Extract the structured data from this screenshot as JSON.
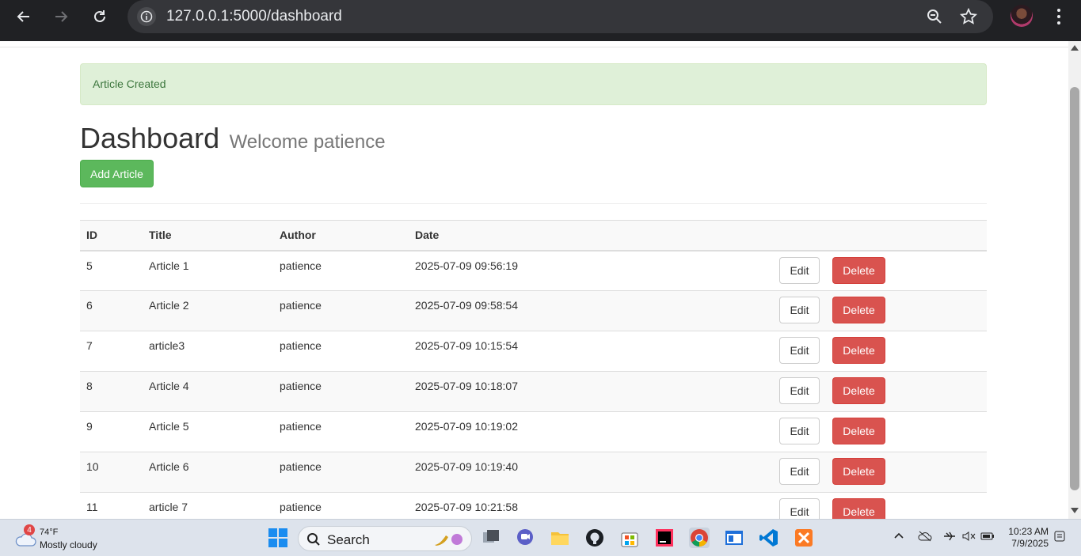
{
  "browser": {
    "url": "127.0.0.1:5000/dashboard"
  },
  "alert": {
    "message": "Article Created"
  },
  "header": {
    "title": "Dashboard",
    "subtitle": "Welcome patience"
  },
  "actions": {
    "add_label": "Add Article"
  },
  "table": {
    "columns": [
      "ID",
      "Title",
      "Author",
      "Date"
    ],
    "rows": [
      {
        "id": "5",
        "title": "Article 1",
        "author": "patience",
        "date": "2025-07-09 09:56:19"
      },
      {
        "id": "6",
        "title": "Article 2",
        "author": "patience",
        "date": "2025-07-09 09:58:54"
      },
      {
        "id": "7",
        "title": "article3",
        "author": "patience",
        "date": "2025-07-09 10:15:54"
      },
      {
        "id": "8",
        "title": "Article 4",
        "author": "patience",
        "date": "2025-07-09 10:18:07"
      },
      {
        "id": "9",
        "title": "Article 5",
        "author": "patience",
        "date": "2025-07-09 10:19:02"
      },
      {
        "id": "10",
        "title": "Article 6",
        "author": "patience",
        "date": "2025-07-09 10:19:40"
      },
      {
        "id": "11",
        "title": "article 7",
        "author": "patience",
        "date": "2025-07-09 10:21:58"
      }
    ],
    "edit_label": "Edit",
    "delete_label": "Delete"
  },
  "taskbar": {
    "weather_temp": "74°F",
    "weather_condition": "Mostly cloudy",
    "weather_badge": "4",
    "search_label": "Search",
    "time": "10:23 AM",
    "date": "7/9/2025"
  },
  "colors": {
    "success": "#5cb85c",
    "danger": "#d9534f",
    "alert_bg": "#dff0d8",
    "alert_text": "#3c763d"
  }
}
